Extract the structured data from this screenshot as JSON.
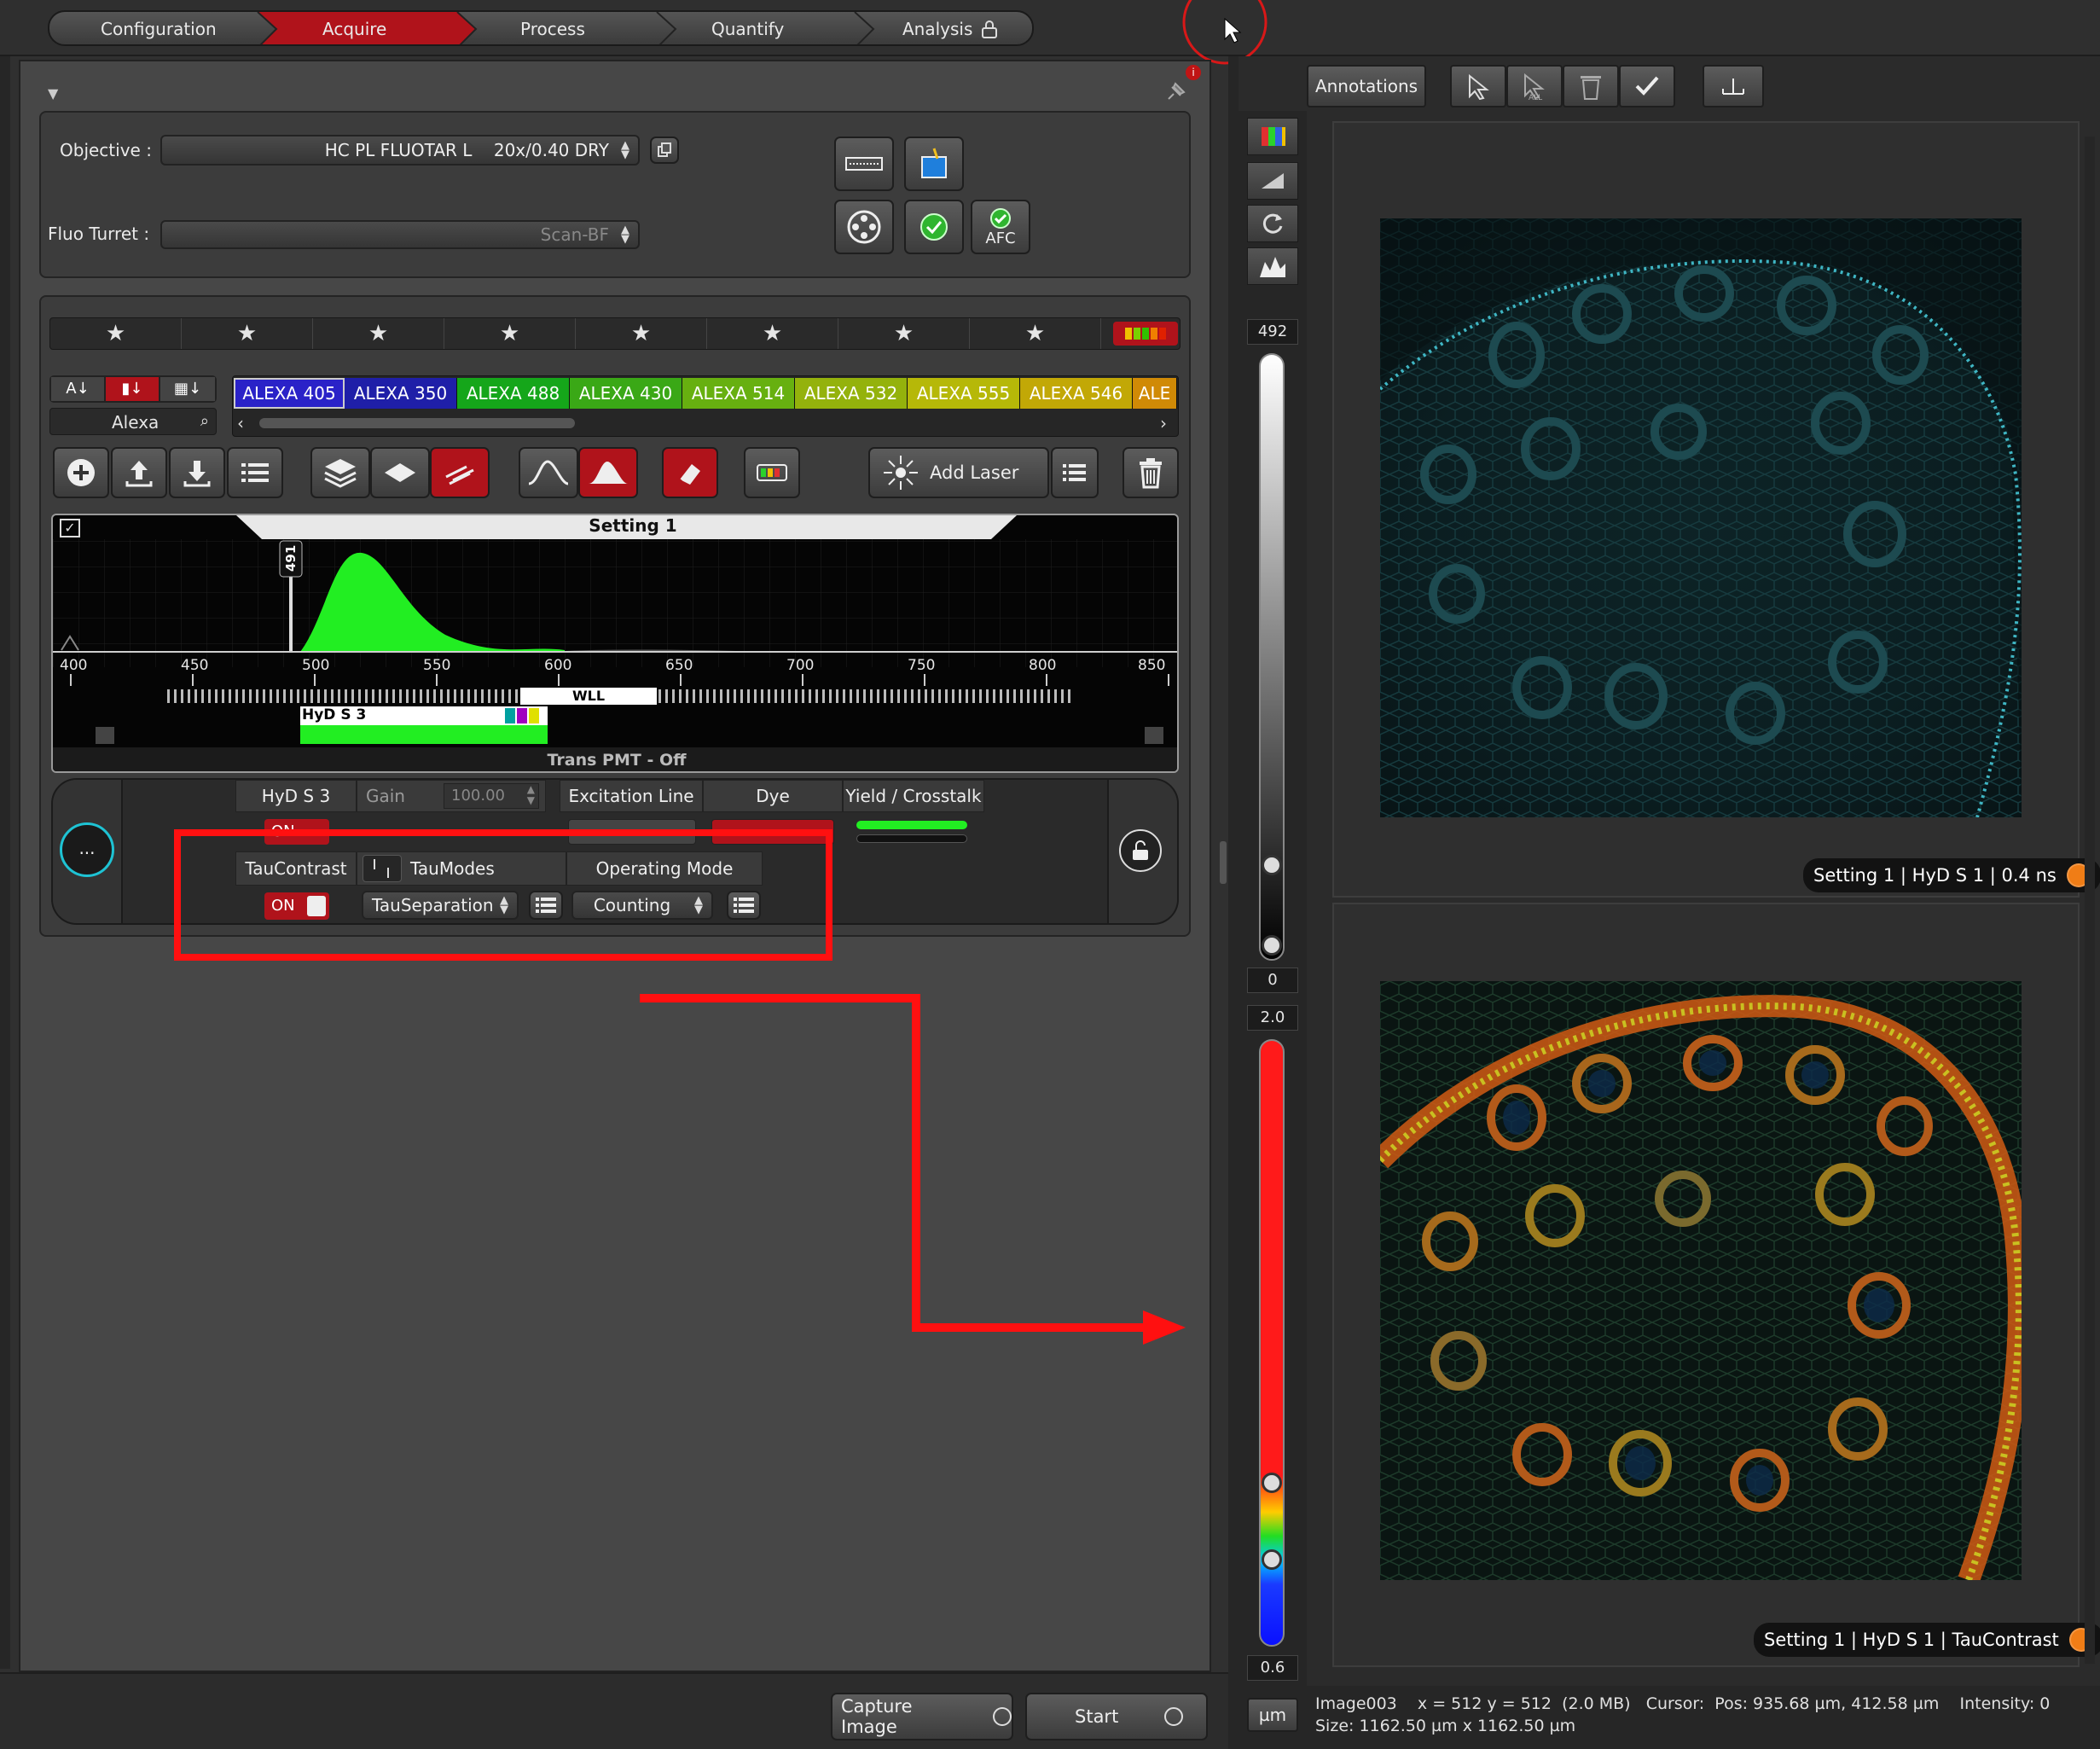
{
  "workflow_tabs": [
    {
      "label": "Configuration",
      "active": false
    },
    {
      "label": "Acquire",
      "active": true
    },
    {
      "label": "Process",
      "active": false
    },
    {
      "label": "Quantify",
      "active": false
    },
    {
      "label": "Analysis",
      "active": false,
      "locked": true
    }
  ],
  "optics": {
    "objective_label": "Objective :",
    "objective_value": "HC PL FLUOTAR L    20x/0.40 DRY",
    "fluo_turret_label": "Fluo Turret :",
    "fluo_turret_value": "Scan-BF",
    "afc_label": "AFC"
  },
  "dyes": {
    "search_value": "Alexa",
    "items": [
      {
        "label": "ALEXA 405",
        "color": "#2a22c8"
      },
      {
        "label": "ALEXA 350",
        "color": "#1f1fa8"
      },
      {
        "label": "ALEXA 488",
        "color": "#15a61a"
      },
      {
        "label": "ALEXA 430",
        "color": "#3aa816"
      },
      {
        "label": "ALEXA 514",
        "color": "#67b010"
      },
      {
        "label": "ALEXA 532",
        "color": "#94b20c"
      },
      {
        "label": "ALEXA 555",
        "color": "#b6b808"
      },
      {
        "label": "ALEXA 546",
        "color": "#c2a806"
      },
      {
        "label": "ALE",
        "color": "#d08a06"
      }
    ]
  },
  "toolbar": {
    "add_laser_label": "Add Laser"
  },
  "spectrum": {
    "setting_title": "Setting 1",
    "laser_line": "491",
    "axis_ticks": [
      "400",
      "450",
      "500",
      "550",
      "600",
      "650",
      "700",
      "750",
      "800",
      "850"
    ],
    "wll_label": "WLL",
    "detector_label": "HyD S 3",
    "trans_pmt_label": "Trans PMT - Off"
  },
  "detector": {
    "name": "HyD S 3",
    "on_label": "ON",
    "gain_label": "Gain",
    "gain_value": "100.00",
    "excitation_header": "Excitation Line",
    "dye_header": "Dye",
    "yield_header": "Yield / Crosstalk",
    "taucontrast_label": "TauContrast",
    "taucontrast_on": "ON",
    "taumodes_label": "TauModes",
    "taumodes_value": "TauSeparation",
    "operating_mode_header": "Operating Mode",
    "operating_mode_value": "Counting",
    "more_label": "..."
  },
  "bottom_bar": {
    "capture_label": "Capture Image",
    "start_label": "Start"
  },
  "viewer": {
    "annotations_label": "Annotations",
    "scale_top_max": "492",
    "scale_top_min": "0",
    "scale_bottom_max": "2.0",
    "scale_bottom_min": "0.6",
    "unit_label": "µm",
    "image1_caption": "Setting 1 | HyD S 1 | 0.4 ns",
    "image2_caption": "Setting 1 | HyD S 1 | TauContrast",
    "status_line1": "Image003    x = 512 y = 512  (2.0 MB)   Cursor:  Pos: 935.68 µm, 412.58 µm    Intensity: 0",
    "status_line2": "Size: 1162.50 µm x 1162.50 µm"
  },
  "colors": {
    "accent_red": "#b0131b",
    "highlight_red": "#ff1010",
    "spectrum_green": "#22ee22"
  }
}
